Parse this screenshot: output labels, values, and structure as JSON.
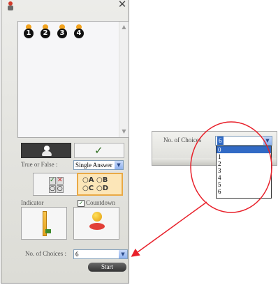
{
  "window": {
    "close_glyph": "✕"
  },
  "contestants": [
    "1",
    "2",
    "3",
    "4"
  ],
  "labels": {
    "true_or_false": "True or False :",
    "mode_value": "Single Answer",
    "tf_icon": [
      "✓",
      "✕",
      "○",
      "○"
    ],
    "abcd": [
      "○A",
      "○B",
      "○C",
      "○D"
    ],
    "indicator": "Indicator",
    "countdown": "Countdown",
    "no_of_choices": "No. of Choices :",
    "choices_value": "6",
    "start": "Start"
  },
  "checkbox": {
    "countdown_checked": true,
    "check_glyph": "✓"
  },
  "zoom": {
    "no_of_choices": "No. of Choices",
    "selected": "6",
    "options": [
      "0",
      "1",
      "2",
      "3",
      "4",
      "5",
      "6"
    ]
  },
  "colors": {
    "callout": "#e8202a",
    "selection": "#316ac5",
    "active_button": "#e9a945"
  }
}
